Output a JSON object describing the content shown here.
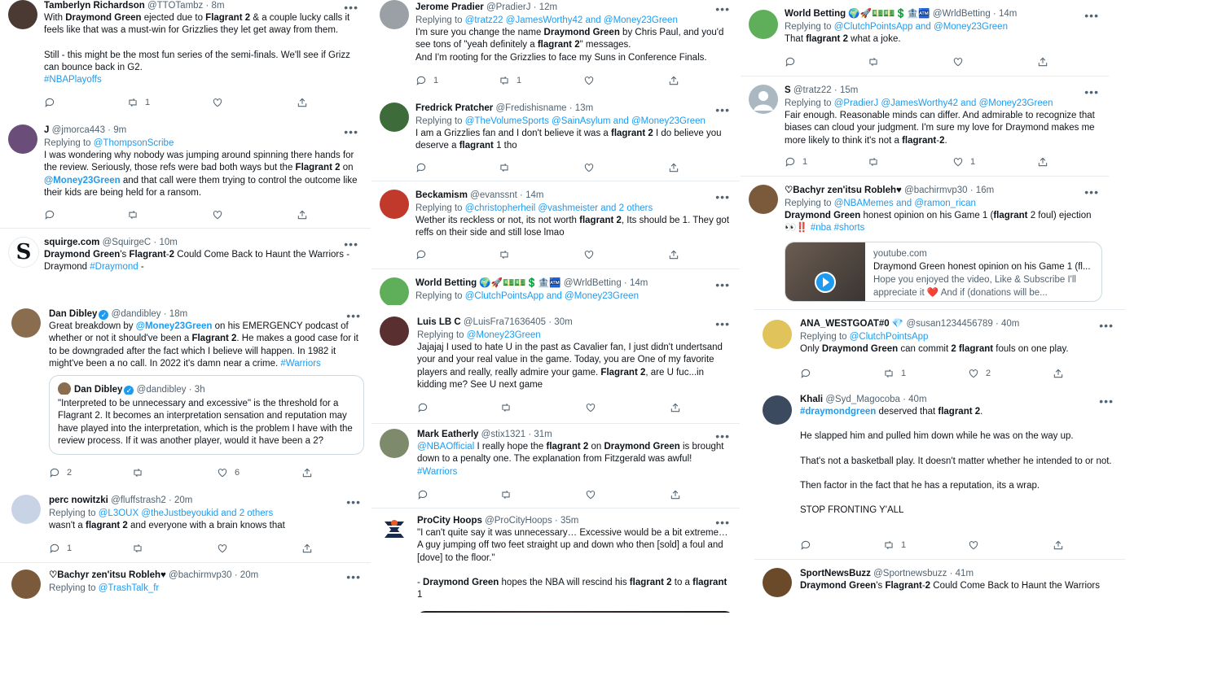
{
  "columns": [
    {
      "tweets": [
        {
          "name": "Tamberlyn Richardson",
          "handle": "@TTOTambz",
          "time": "8m",
          "avatar_color": "#4a3a33",
          "text": [
            {
              "segs": [
                {
                  "t": "With "
                },
                {
                  "t": "Draymond Green",
                  "b": true
                },
                {
                  "t": " ejected due to "
                },
                {
                  "t": "Flagrant 2",
                  "b": true
                },
                {
                  "t": " & a couple lucky calls it feels like that was a must-win for  Grizzlies they let get away from them."
                }
              ]
            },
            {
              "gap": true,
              "segs": [
                {
                  "t": "Still - this might be the most fun series of the semi-finals. We'll see if Grizz can bounce back in G2."
                }
              ]
            },
            {
              "segs": [
                {
                  "t": "#NBAPlayoffs",
                  "l": true
                }
              ]
            }
          ],
          "stats": {
            "reply": "",
            "retweet": "1",
            "like": "",
            "share": ""
          }
        },
        {
          "name": "J",
          "handle": "@jmorca443",
          "time": "9m",
          "avatar_color": "#6b4d7a",
          "replying_prefix": "Replying to",
          "replying_to": "@ThompsonScribe",
          "text": [
            {
              "segs": [
                {
                  "t": "I was wondering why nobody was jumping around spinning there hands for the review.  Seriously, those refs were bad both ways but the "
                },
                {
                  "t": "Flagrant 2",
                  "b": true
                },
                {
                  "t": " on "
                },
                {
                  "t": "@Money23Green",
                  "l": true,
                  "b": true
                },
                {
                  "t": " and that call were them trying to control the outcome like their kids are being held for a ransom."
                }
              ]
            }
          ],
          "stats": {
            "reply": "",
            "retweet": "",
            "like": "",
            "share": ""
          }
        },
        {
          "name": "squirge.com",
          "handle": "@SquirgeC",
          "time": "10m",
          "avatar_letter": "S",
          "avatar_color": "#ffffff",
          "text": [
            {
              "segs": [
                {
                  "t": "Draymond Green",
                  "b": true
                },
                {
                  "t": "'s "
                },
                {
                  "t": "Flagrant",
                  "b": true
                },
                {
                  "t": "-"
                },
                {
                  "t": "2",
                  "b": true
                },
                {
                  "t": " Could Come Back to Haunt the Warriors - Draymond "
                },
                {
                  "t": "#Draymond",
                  "l": true
                },
                {
                  "t": " -"
                }
              ]
            }
          ],
          "stats": null
        },
        {
          "name": "Dan Dibley",
          "verified": true,
          "handle": "@dandibley",
          "time": "18m",
          "avatar_color": "#8a6d4f",
          "text": [
            {
              "segs": [
                {
                  "t": "Great breakdown by "
                },
                {
                  "t": "@Money23Green",
                  "l": true,
                  "b": true
                },
                {
                  "t": " on his EMERGENCY podcast of whether or not it should've been a "
                },
                {
                  "t": "Flagrant 2",
                  "b": true
                },
                {
                  "t": ". He makes a good case for it to be downgraded after the fact which I believe will happen. In 1982 it might've been a no call. In 2022 it's damn near a crime. "
                },
                {
                  "t": "#Warriors",
                  "l": true
                }
              ]
            }
          ],
          "quote": {
            "name": "Dan Dibley",
            "handle": "@dandibley",
            "time": "3h",
            "text": "\"Interpreted to be unnecessary and excessive\" is the threshold for a Flagrant 2. It becomes an interpretation sensation and reputation may have played into the interpretation, which is the problem I have with the review process. If it was another player, would it have been a 2?"
          },
          "stats": {
            "reply": "2",
            "retweet": "",
            "like": "6",
            "share": ""
          }
        },
        {
          "name": "perc nowitzki",
          "handle": "@fluffstrash2",
          "time": "20m",
          "avatar_color": "#c9d3e6",
          "replying_prefix": "Replying to",
          "replying_to": "@L3OUX @theJustbeyoukid and 2 others",
          "text": [
            {
              "segs": [
                {
                  "t": "wasn't a "
                },
                {
                  "t": "flagrant 2",
                  "b": true
                },
                {
                  "t": " and everyone with a brain knows that"
                }
              ]
            }
          ],
          "stats": {
            "reply": "1",
            "retweet": "",
            "like": "",
            "share": ""
          }
        },
        {
          "name": "♡Bachyr zen'itsu Robleh♥",
          "handle": "@bachirmvp30",
          "time": "20m",
          "avatar_color": "#7a5a3a",
          "replying_prefix": "Replying to",
          "replying_to": "@TrashTalk_fr",
          "text": [],
          "stats": null
        }
      ]
    },
    {
      "tweets": [
        {
          "name": "Jerome Pradier",
          "handle": "@PradierJ",
          "time": "12m",
          "avatar_color": "#9aa0a6",
          "replying_prefix": "Replying to",
          "replying_to": "@tratz22 @JamesWorthy42 and @Money23Green",
          "text": [
            {
              "segs": [
                {
                  "t": "I'm sure you change the name "
                },
                {
                  "t": "Draymond Green",
                  "b": true
                },
                {
                  "t": " by Chris Paul, and you'd see tons of \"yeah definitely a "
                },
                {
                  "t": "flagrant 2",
                  "b": true
                },
                {
                  "t": "\" messages."
                }
              ]
            },
            {
              "segs": [
                {
                  "t": "And I'm rooting for the Grizzlies to face my Suns in Conference Finals."
                }
              ]
            }
          ],
          "stats": {
            "reply": "1",
            "retweet": "1",
            "like": "",
            "share": ""
          }
        },
        {
          "name": "Fredrick Pratcher",
          "handle": "@Fredishisname",
          "time": "13m",
          "avatar_color": "#3d6b3a",
          "replying_prefix": "Replying to",
          "replying_to": "@TheVolumeSports @SainAsylum and @Money23Green",
          "text": [
            {
              "segs": [
                {
                  "t": "I am a Grizzlies fan and I don't believe it was a "
                },
                {
                  "t": "flagrant 2",
                  "b": true
                },
                {
                  "t": " I do believe you deserve a "
                },
                {
                  "t": "flagrant",
                  "b": true
                },
                {
                  "t": " 1 tho"
                }
              ]
            }
          ],
          "stats": {
            "reply": "",
            "retweet": "",
            "like": "",
            "share": ""
          }
        },
        {
          "name": "Beckamism",
          "handle": "@evanssnt",
          "time": "14m",
          "avatar_color": "#c0392b",
          "replying_prefix": "Replying to",
          "replying_to": "@christopherheil @vashmeister and 2 others",
          "text": [
            {
              "segs": [
                {
                  "t": "Wether its reckless or not, its not worth "
                },
                {
                  "t": "flagrant 2",
                  "b": true
                },
                {
                  "t": ", Its should be 1. They got reffs on their side and still lose lmao"
                }
              ]
            }
          ],
          "stats": {
            "reply": "",
            "retweet": "",
            "like": "",
            "share": ""
          }
        },
        {
          "name": "World Betting",
          "emoji": "🌍🚀💵💵💲🏦🏧",
          "handle": "@WrldBetting",
          "time": "14m",
          "avatar_color": "#5fae5a",
          "replying_prefix": "Replying to",
          "replying_to": "@ClutchPointsApp and @Money23Green",
          "text": [],
          "stats": null
        },
        {
          "name": "Luis LB C",
          "handle": "@LuisFra71636405",
          "time": "30m",
          "avatar_color": "#5a2f2f",
          "replying_prefix": "Replying to",
          "replying_to": "@Money23Green",
          "text": [
            {
              "segs": [
                {
                  "t": "Jajajaj I used to hate U in the past as Cavalier fan, I just didn't undertsand your and your real value in the game.  Today, you are One of my favorite players and really, really admire your game. "
                },
                {
                  "t": "Flagrant 2",
                  "b": true
                },
                {
                  "t": ", are U fuc...in kidding me? See U next game"
                }
              ]
            }
          ],
          "stats": {
            "reply": "",
            "retweet": "",
            "like": "",
            "share": ""
          }
        },
        {
          "name": "Mark Eatherly",
          "handle": "@stix1321",
          "time": "31m",
          "avatar_color": "#7d8a6b",
          "text": [
            {
              "segs": [
                {
                  "t": "@NBAOfficial",
                  "l": true
                },
                {
                  "t": " I really hope the "
                },
                {
                  "t": "flagrant 2",
                  "b": true
                },
                {
                  "t": " on "
                },
                {
                  "t": "Draymond Green",
                  "b": true
                },
                {
                  "t": " is brought down to a penalty one. The explanation from Fitzgerald was awful! "
                },
                {
                  "t": "#Warriors",
                  "l": true
                }
              ]
            }
          ],
          "stats": {
            "reply": "",
            "retweet": "",
            "like": "",
            "share": ""
          }
        },
        {
          "name": "ProCity Hoops",
          "handle": "@ProCityHoops",
          "time": "35m",
          "avatar_color": "#ffffff",
          "text": [
            {
              "segs": [
                {
                  "t": "\"I can't quite say it was unnecessary… Excessive would be a bit extreme… A guy jumping off two feet straight up and down who then [sold] a foul and [dove] to the floor.\""
                }
              ]
            },
            {
              "gap": true,
              "segs": [
                {
                  "t": "- "
                },
                {
                  "t": "Draymond Green",
                  "b": true
                },
                {
                  "t": " hopes the NBA will rescind his "
                },
                {
                  "t": "flagrant 2",
                  "b": true
                },
                {
                  "t": " to a "
                },
                {
                  "t": "flagrant",
                  "b": true
                },
                {
                  "t": " 1"
                }
              ]
            }
          ],
          "has_media": true,
          "stats": null
        }
      ]
    },
    {
      "tweets": [
        {
          "name": "World Betting",
          "emoji": "🌍🚀💵💵💲🏦🏧",
          "handle": "@WrldBetting",
          "time": "14m",
          "avatar_color": "#5fae5a",
          "replying_prefix": "Replying to",
          "replying_to": "@ClutchPointsApp and @Money23Green",
          "text": [
            {
              "segs": [
                {
                  "t": "That "
                },
                {
                  "t": "flagrant 2",
                  "b": true
                },
                {
                  "t": " what a joke."
                }
              ]
            }
          ],
          "stats": {
            "reply": "",
            "retweet": "",
            "like": "",
            "share": ""
          }
        },
        {
          "name": "S",
          "handle": "@tratz22",
          "time": "15m",
          "avatar_color": "#aab8c2",
          "replying_prefix": "Replying to",
          "replying_to": "@PradierJ @JamesWorthy42 and @Money23Green",
          "text": [
            {
              "segs": [
                {
                  "t": "Fair enough. Reasonable minds can differ. And admirable to recognize that biases can cloud your judgment. I'm sure my love for Draymond makes me more likely to think it's not a "
                },
                {
                  "t": "flagrant",
                  "b": true
                },
                {
                  "t": "-"
                },
                {
                  "t": "2",
                  "b": true
                },
                {
                  "t": "."
                }
              ]
            }
          ],
          "stats": {
            "reply": "1",
            "retweet": "",
            "like": "1",
            "share": ""
          }
        },
        {
          "name": "♡Bachyr zen'itsu Robleh♥",
          "handle": "@bachirmvp30",
          "time": "16m",
          "avatar_color": "#7a5a3a",
          "replying_prefix": "Replying to",
          "replying_to": "@NBAMemes and @ramon_rican",
          "text": [
            {
              "segs": [
                {
                  "t": "Draymond Green",
                  "b": true
                },
                {
                  "t": " honest opinion on his Game 1 ("
                },
                {
                  "t": "flagrant",
                  "b": true
                },
                {
                  "t": " 2 foul) ejection"
                }
              ]
            },
            {
              "segs": [
                {
                  "t": "👀‼️ "
                },
                {
                  "t": "#nba #shorts",
                  "l": true
                }
              ]
            }
          ],
          "card": {
            "domain": "youtube.com",
            "title": "Draymond Green honest opinion on his Game 1 (fl...",
            "desc": "Hope you enjoyed the video, Like & Subscribe I'll appreciate it ❤️ And if (donations will be..."
          },
          "stats": null
        },
        {
          "name": "ANA_WESTGOAT#0",
          "emoji": "💎",
          "handle": "@susan1234456789",
          "time": "40m",
          "avatar_color": "#e0c35a",
          "replying_prefix": "Replying to",
          "replying_to": "@ClutchPointsApp",
          "text": [
            {
              "segs": [
                {
                  "t": "Only "
                },
                {
                  "t": "Draymond Green",
                  "b": true
                },
                {
                  "t": " can commit "
                },
                {
                  "t": "2 flagrant",
                  "b": true
                },
                {
                  "t": " fouls on one play."
                }
              ]
            }
          ],
          "stats": {
            "reply": "",
            "retweet": "1",
            "like": "2",
            "share": ""
          }
        },
        {
          "name": "Khali",
          "handle": "@Syd_Magocoba",
          "time": "40m",
          "avatar_color": "#3b4a5e",
          "text": [
            {
              "segs": [
                {
                  "t": "#draymondgreen",
                  "l": true,
                  "b": true
                },
                {
                  "t": " deserved that "
                },
                {
                  "t": "flagrant 2",
                  "b": true
                },
                {
                  "t": "."
                }
              ]
            },
            {
              "gap": true,
              "segs": [
                {
                  "t": "He slapped him and pulled him down while he was on the way up."
                }
              ]
            },
            {
              "gap": true,
              "segs": [
                {
                  "t": "That's not a basketball play. It doesn't matter whether he intended to or not."
                }
              ]
            },
            {
              "gap": true,
              "segs": [
                {
                  "t": "Then factor in the fact that he has a reputation, its a wrap."
                }
              ]
            },
            {
              "gap": true,
              "segs": [
                {
                  "t": "STOP FRONTING Y'ALL"
                }
              ]
            }
          ],
          "stats": {
            "reply": "",
            "retweet": "1",
            "like": "",
            "share": ""
          }
        },
        {
          "name": "SportNewsBuzz",
          "handle": "@Sportnewsbuzz",
          "time": "41m",
          "avatar_color": "#6b4a2a",
          "text": [
            {
              "segs": [
                {
                  "t": "Draymond Green",
                  "b": true
                },
                {
                  "t": "'s "
                },
                {
                  "t": "Flagrant",
                  "b": true
                },
                {
                  "t": "-"
                },
                {
                  "t": "2",
                  "b": true
                },
                {
                  "t": " Could Come Back to Haunt the Warriors"
                }
              ]
            }
          ],
          "stats": null
        }
      ]
    }
  ],
  "more_label": "•••",
  "colors": {
    "link": "#1d9bf0",
    "muted": "#536471",
    "divider": "#e6ecf0"
  }
}
